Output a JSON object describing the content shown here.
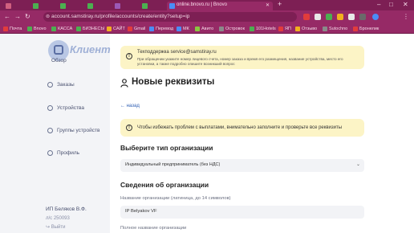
{
  "browser": {
    "tabs": [
      {
        "label": ""
      },
      {
        "label": ""
      },
      {
        "label": ""
      },
      {
        "label": ""
      },
      {
        "label": ""
      },
      {
        "label": ""
      },
      {
        "label": "online.bnovo.ru | Bnovo",
        "active": true
      }
    ],
    "url": "account.samstiray.ru/profile/accounts/create/entity?setup=ip",
    "window_controls": {
      "minimize": "–",
      "maximize": "□",
      "close": "✕"
    },
    "bookmarks": [
      {
        "label": "Почта",
        "color": "#e23c3c"
      },
      {
        "label": "Bnovo",
        "color": "#4caf50"
      },
      {
        "label": "КАССА",
        "color": "#4caf50"
      },
      {
        "label": "БИЗНЕСЫ",
        "color": "#4caf50"
      },
      {
        "label": "САЙТ",
        "color": "#f2b01e"
      },
      {
        "label": "Gmail",
        "color": "#e23c3c"
      },
      {
        "label": "Перевод",
        "color": "#4a8df6"
      },
      {
        "label": "МК",
        "color": "#4a8df6"
      },
      {
        "label": "Авито",
        "color": "#8ac640"
      },
      {
        "label": "Островок",
        "color": "#8a8a8a"
      },
      {
        "label": "101Hotels",
        "color": "#4caf50"
      },
      {
        "label": "ЯП",
        "color": "#e23c3c"
      },
      {
        "label": "Отзыво",
        "color": "#f2b01e"
      },
      {
        "label": "Sutochno",
        "color": "#8a8a8a"
      },
      {
        "label": "Бронелик",
        "color": "#e23c3c"
      }
    ]
  },
  "sidebar": {
    "brand": "Клиент",
    "items": [
      {
        "label": "Обзор"
      },
      {
        "label": "Заказы"
      },
      {
        "label": "Устройства"
      },
      {
        "label": "Группы устройств"
      },
      {
        "label": "Профиль"
      }
    ],
    "account_name": "ИП Беляков В.Ф.",
    "account_id": "л/с 250093",
    "logout": "Выйти"
  },
  "support": {
    "title": "Техподдержка service@samstiray.ru",
    "text": "При обращении укажите номер лицевого счета, номер заказа и время его размещения, название устройства, место его установки, а также подробно опишите возникший вопрос"
  },
  "page_title": "Новые реквизиты",
  "back_link": "← назад",
  "warning": "Чтобы избежать проблем с выплатами, внимательно заполните и проверьте все реквизиты",
  "org_type": {
    "title": "Выберите тип организации",
    "selected": "Индивидуальный предприниматель (без НДС)"
  },
  "org_info": {
    "title": "Сведения об организации",
    "name_label": "Название организации (латиница, до 14 символов)",
    "name_value": "IP Belyakov VF",
    "full_name_label": "Полное название организации"
  },
  "colors": {
    "browser_dark": "#7d1f54",
    "browser_mid": "#962a66",
    "banner": "#fcf4c6",
    "link": "#2f5fb3"
  }
}
